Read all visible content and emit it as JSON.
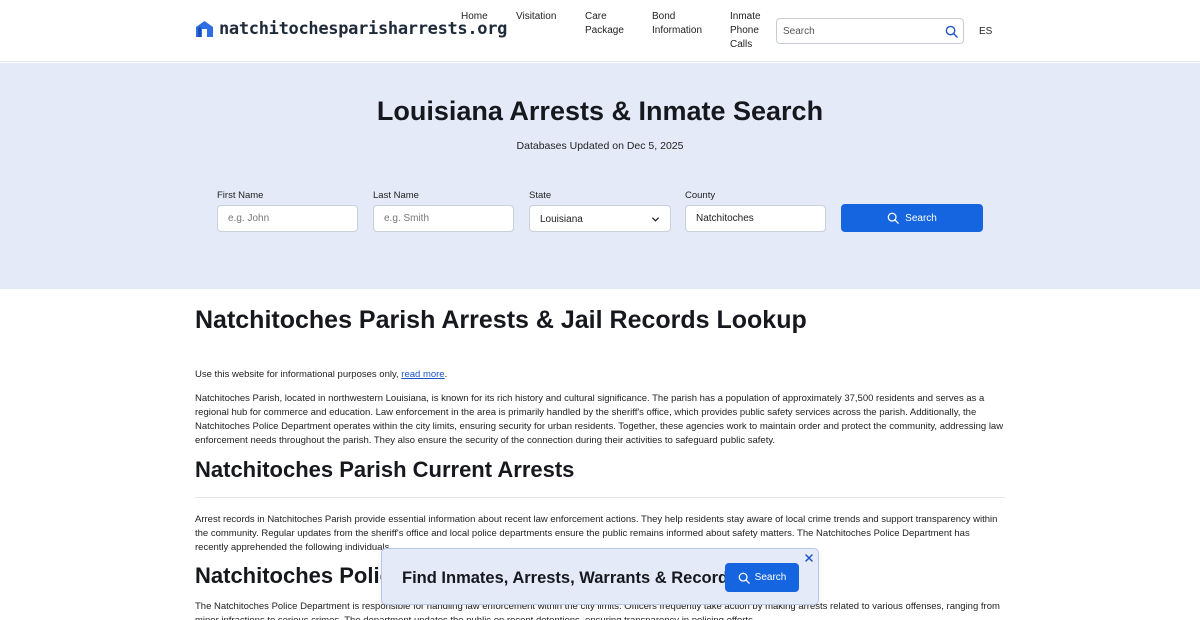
{
  "header": {
    "site_name": "natchitochesparisharrests.org",
    "nav": [
      {
        "label": "Home"
      },
      {
        "label": "Visitation"
      },
      {
        "label": "Care\nPackage"
      },
      {
        "label": "Bond\nInformation"
      },
      {
        "label": "Inmate\nPhone\nCalls"
      }
    ],
    "search_placeholder": "Search",
    "lang": "ES"
  },
  "hero": {
    "title": "Louisiana Arrests & Inmate Search",
    "subtitle": "Databases Updated on Dec 5, 2025",
    "first_name_label": "First Name",
    "first_name_placeholder": "e.g. John",
    "last_name_label": "Last Name",
    "last_name_placeholder": "e.g. Smith",
    "state_label": "State",
    "state_value": "Louisiana",
    "county_label": "County",
    "county_value": "Natchitoches",
    "search_label": "Search"
  },
  "content": {
    "h1": "Natchitoches Parish Arrests & Jail Records Lookup",
    "disclaimer_prefix": "Use this website for informational purposes only, ",
    "disclaimer_link": "read more",
    "disclaimer_suffix": ".",
    "intro": "Natchitoches Parish, located in northwestern Louisiana, is known for its rich history and cultural significance. The parish has a population of approximately 37,500 residents and serves as a regional hub for commerce and education. Law enforcement in the area is primarily handled by the sheriff's office, which provides public safety services across the parish. Additionally, the Natchitoches Police Department operates within the city limits, ensuring security for urban residents. Together, these agencies work to maintain order and protect the community, addressing law enforcement needs throughout the parish. They also ensure the security of the connection during their activities to safeguard public safety.",
    "h2_current": "Natchitoches Parish Current Arrests",
    "arrests_text": "Arrest records in Natchitoches Parish provide essential information about recent law enforcement actions. They help residents stay aware of local crime trends and support transparency within the community. Regular updates from the sheriff's office and local police departments ensure the public remains informed about safety matters. The Natchitoches Police Department has recently apprehended the following individuals.",
    "h2_police": "Natchitoches Police Department",
    "police_text": "The Natchitoches Police Department is responsible for handling law enforcement within the city limits. Officers frequently take action by making arrests related to various offenses, ranging from minor infractions to serious crimes. The department updates the public on recent detentions, ensuring transparency in policing efforts."
  },
  "banner": {
    "text": "Find Inmates, Arrests, Warrants & Records",
    "button_label": "Search"
  },
  "colors": {
    "accent": "#1565e0",
    "hero_bg": "#e4eaf8"
  }
}
